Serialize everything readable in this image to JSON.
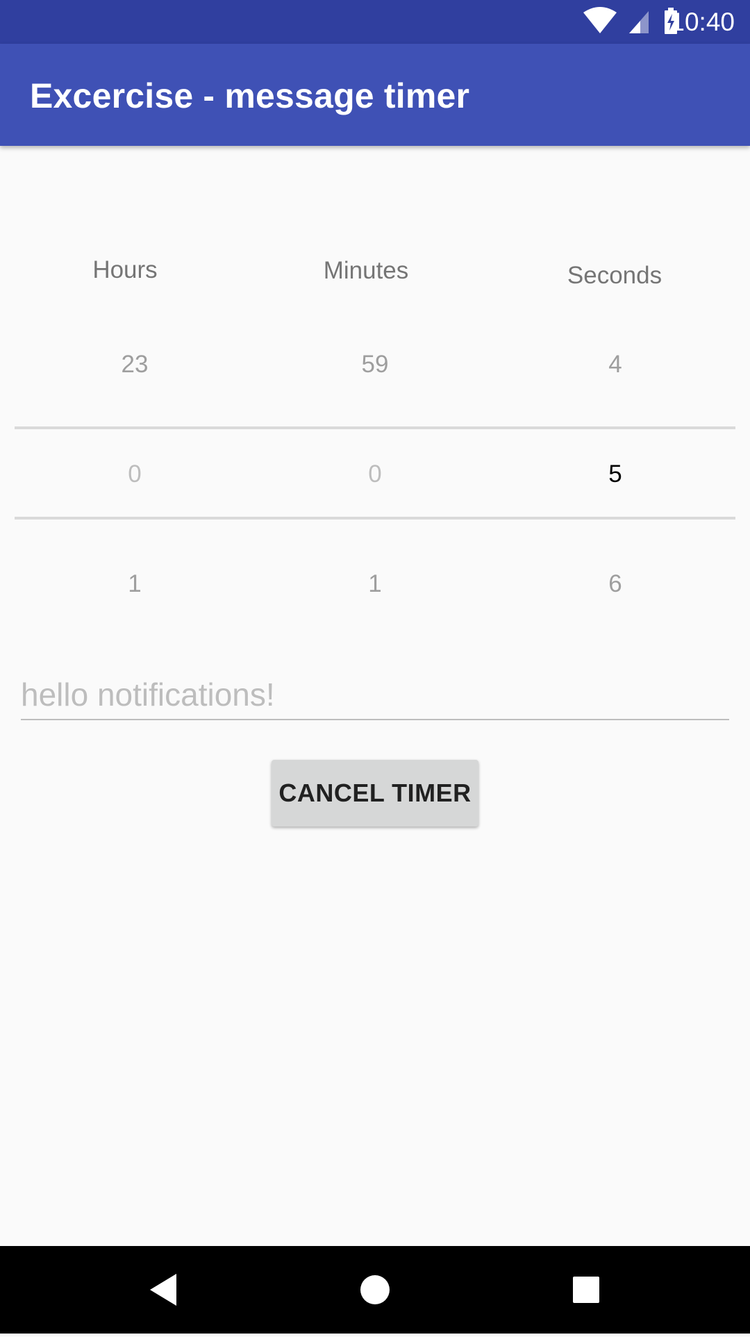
{
  "status_bar": {
    "time": "10:40",
    "icons": [
      "wifi-icon",
      "cell-signal-icon",
      "battery-charging-icon"
    ]
  },
  "app_bar": {
    "title": "Excercise - message timer"
  },
  "picker": {
    "columns": [
      {
        "label": "Hours",
        "above": "23",
        "selected": "0",
        "below": "1"
      },
      {
        "label": "Minutes",
        "above": "59",
        "selected": "0",
        "below": "1"
      },
      {
        "label": "Seconds",
        "above": "4",
        "selected": "5",
        "below": "6"
      }
    ]
  },
  "message": {
    "placeholder": "hello notifications!",
    "value": ""
  },
  "cancel_button": {
    "label": "CANCEL TIMER"
  },
  "nav_bar": {
    "icons": [
      "back-icon",
      "home-icon",
      "recents-icon"
    ]
  },
  "colors": {
    "status_bar": "#303f9f",
    "app_bar": "#3f51b5",
    "background": "#fafafa",
    "button": "#d6d7d7"
  }
}
